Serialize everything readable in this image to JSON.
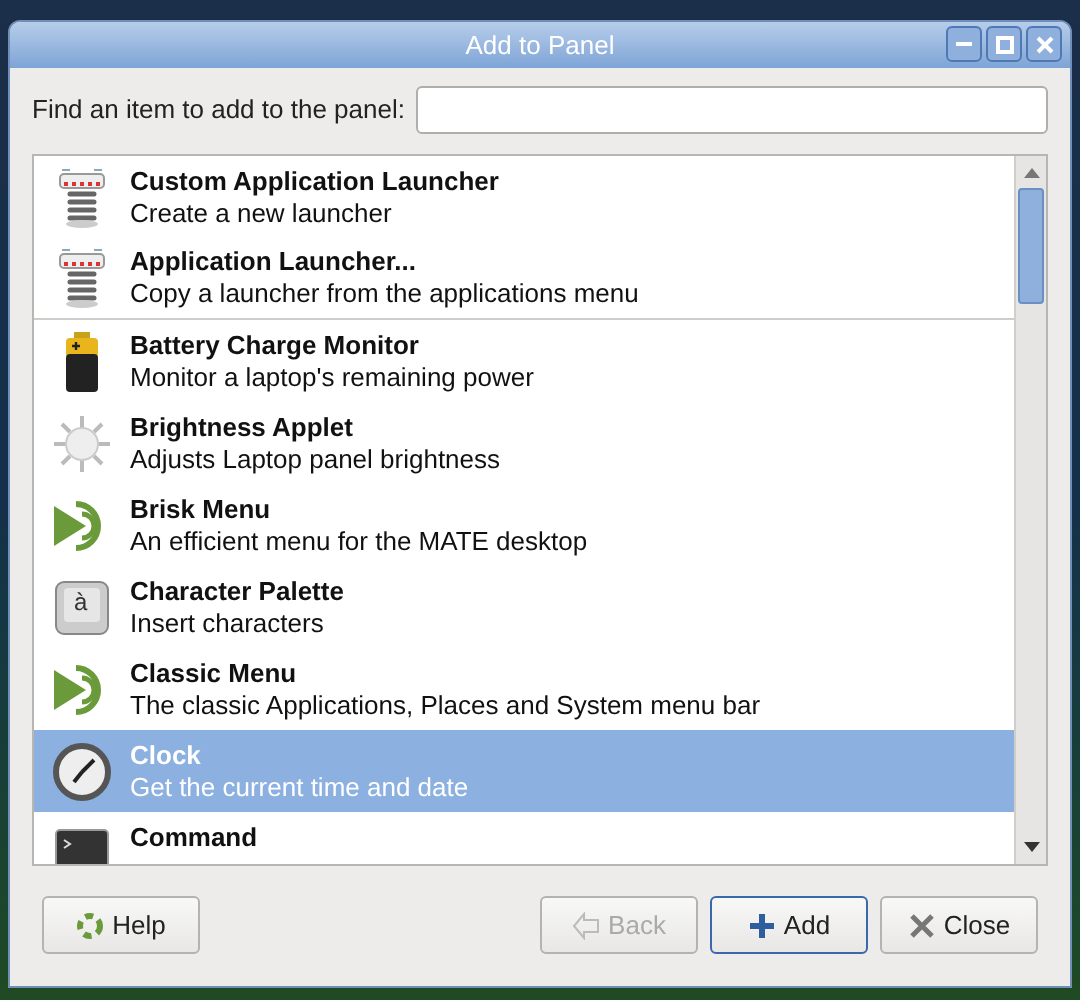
{
  "window": {
    "title": "Add to Panel"
  },
  "search": {
    "label": "Find an item to add to the panel:"
  },
  "items": [
    {
      "kind": "launcher",
      "title": "Custom Application Launcher",
      "description": "Create a new launcher",
      "selected": false,
      "separator_after": false
    },
    {
      "kind": "launcher",
      "title": "Application Launcher...",
      "description": "Copy a launcher from the applications menu",
      "selected": false,
      "separator_after": true
    },
    {
      "kind": "battery",
      "title": "Battery Charge Monitor",
      "description": "Monitor a laptop's remaining power",
      "selected": false,
      "separator_after": false
    },
    {
      "kind": "sun",
      "title": "Brightness Applet",
      "description": "Adjusts Laptop panel brightness",
      "selected": false,
      "separator_after": false
    },
    {
      "kind": "menu",
      "title": "Brisk Menu",
      "description": "An efficient menu for the MATE desktop",
      "selected": false,
      "separator_after": false
    },
    {
      "kind": "charkey",
      "icon_text": "à",
      "title": "Character Palette",
      "description": "Insert characters",
      "selected": false,
      "separator_after": false
    },
    {
      "kind": "menu",
      "title": "Classic Menu",
      "description": "The classic Applications, Places and System menu bar",
      "selected": false,
      "separator_after": false
    },
    {
      "kind": "clock",
      "title": "Clock",
      "description": "Get the current time and date",
      "selected": true,
      "separator_after": false
    },
    {
      "kind": "terminal",
      "title": "Command",
      "selected": false,
      "separator_after": false
    }
  ],
  "buttons": [
    {
      "kind": "help",
      "label": "Help",
      "disabled": false,
      "default": false
    },
    {
      "kind": "back",
      "label": "Back",
      "disabled": true,
      "default": false
    },
    {
      "kind": "add",
      "label": "Add",
      "disabled": false,
      "default": true
    },
    {
      "kind": "close",
      "label": "Close",
      "disabled": false,
      "default": false
    }
  ]
}
